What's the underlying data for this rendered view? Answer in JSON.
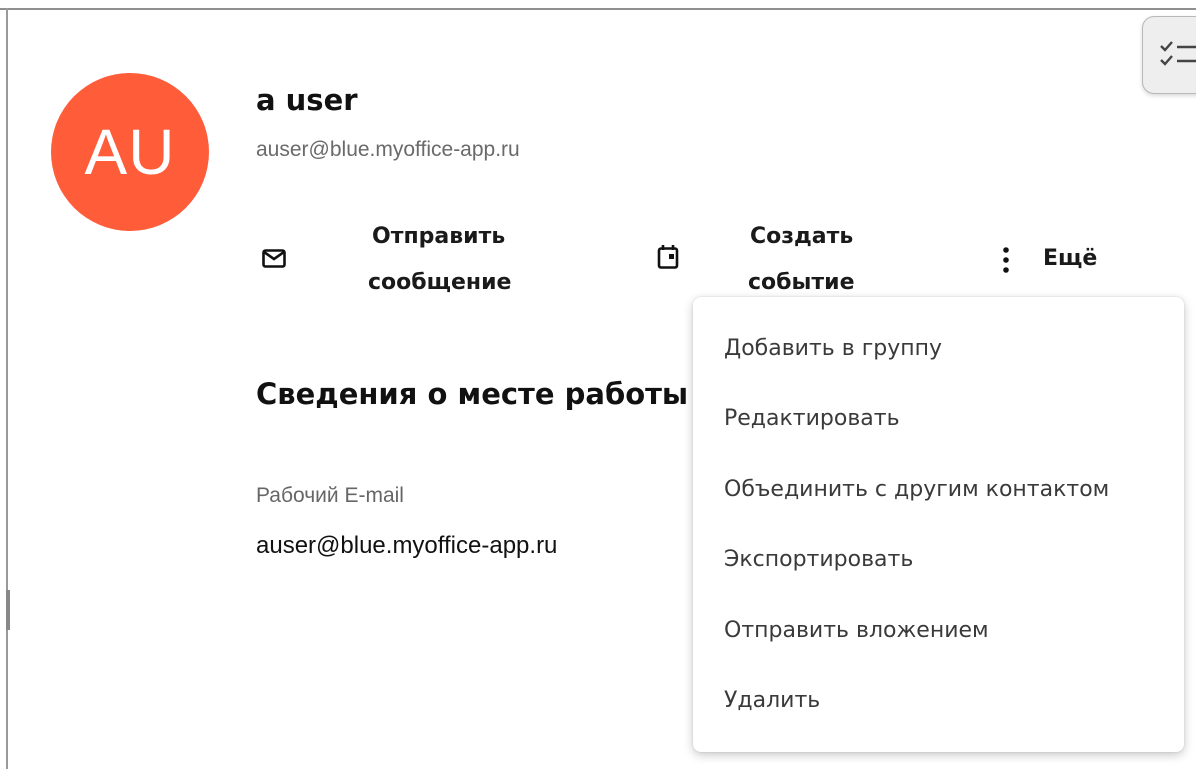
{
  "contact": {
    "avatar_initials": "AU",
    "avatar_color": "#ff5c39",
    "name": "a user",
    "email": "auser@blue.myoffice-app.ru"
  },
  "actions": {
    "send_message": {
      "line1": "Отправить",
      "line2": "сообщение",
      "icon": "envelope-icon"
    },
    "create_event": {
      "line1": "Создать",
      "line2": "событие",
      "icon": "calendar-icon"
    },
    "more": {
      "label": "Ещё",
      "icon": "more-vertical-icon"
    }
  },
  "work_info": {
    "title": "Сведения о месте работы",
    "fields": [
      {
        "label": "Рабочий E-mail",
        "value": "auser@blue.myoffice-app.ru"
      }
    ]
  },
  "more_menu": {
    "items": [
      "Добавить в группу",
      "Редактировать",
      "Объединить с другим контактом",
      "Экспортировать",
      "Отправить вложением",
      "Удалить"
    ]
  },
  "side_panel": {
    "tasks_icon": "checklist-icon"
  }
}
